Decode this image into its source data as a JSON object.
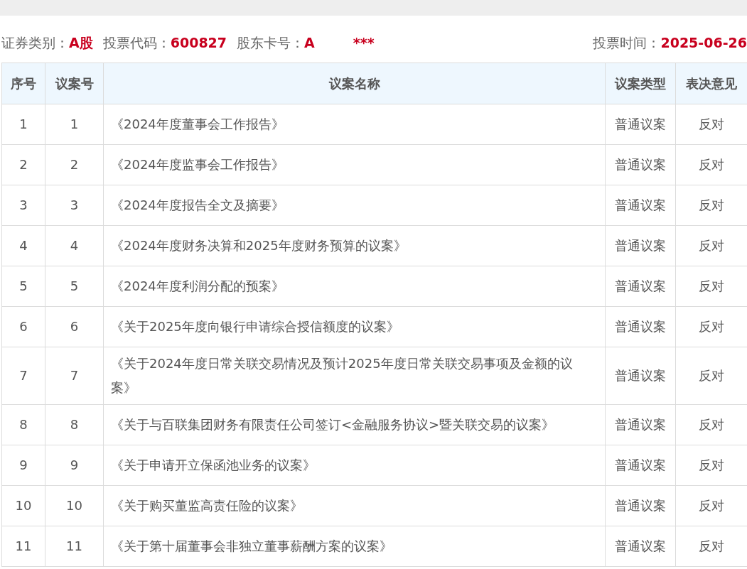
{
  "info": {
    "security_type_label": "证券类别：",
    "security_type": "A股",
    "vote_code_label": "投票代码：",
    "vote_code": "600827",
    "holder_card_label": "股东卡号：",
    "holder_card": "A",
    "holder_card_masked": "***",
    "vote_time_label": "投票时间：",
    "vote_time": "2025-06-26"
  },
  "table": {
    "columns": [
      "序号",
      "议案号",
      "议案名称",
      "议案类型",
      "表决意见"
    ],
    "rows": [
      {
        "seq": "1",
        "motion_no": "1",
        "name": "《2024年度董事会工作报告》",
        "type": "普通议案",
        "opinion": "反对"
      },
      {
        "seq": "2",
        "motion_no": "2",
        "name": "《2024年度监事会工作报告》",
        "type": "普通议案",
        "opinion": "反对"
      },
      {
        "seq": "3",
        "motion_no": "3",
        "name": "《2024年度报告全文及摘要》",
        "type": "普通议案",
        "opinion": "反对"
      },
      {
        "seq": "4",
        "motion_no": "4",
        "name": "《2024年度财务决算和2025年度财务预算的议案》",
        "type": "普通议案",
        "opinion": "反对"
      },
      {
        "seq": "5",
        "motion_no": "5",
        "name": "《2024年度利润分配的预案》",
        "type": "普通议案",
        "opinion": "反对"
      },
      {
        "seq": "6",
        "motion_no": "6",
        "name": "《关于2025年度向银行申请综合授信额度的议案》",
        "type": "普通议案",
        "opinion": "反对"
      },
      {
        "seq": "7",
        "motion_no": "7",
        "name": "《关于2024年度日常关联交易情况及预计2025年度日常关联交易事项及金额的议案》",
        "type": "普通议案",
        "opinion": "反对"
      },
      {
        "seq": "8",
        "motion_no": "8",
        "name": "《关于与百联集团财务有限责任公司签订<金融服务协议>暨关联交易的议案》",
        "type": "普通议案",
        "opinion": "反对"
      },
      {
        "seq": "9",
        "motion_no": "9",
        "name": "《关于申请开立保函池业务的议案》",
        "type": "普通议案",
        "opinion": "反对"
      },
      {
        "seq": "10",
        "motion_no": "10",
        "name": "《关于购买董监高责任险的议案》",
        "type": "普通议案",
        "opinion": "反对"
      },
      {
        "seq": "11",
        "motion_no": "11",
        "name": "《关于第十届董事会非独立董事薪酬方案的议案》",
        "type": "普通议案",
        "opinion": "反对"
      }
    ]
  }
}
